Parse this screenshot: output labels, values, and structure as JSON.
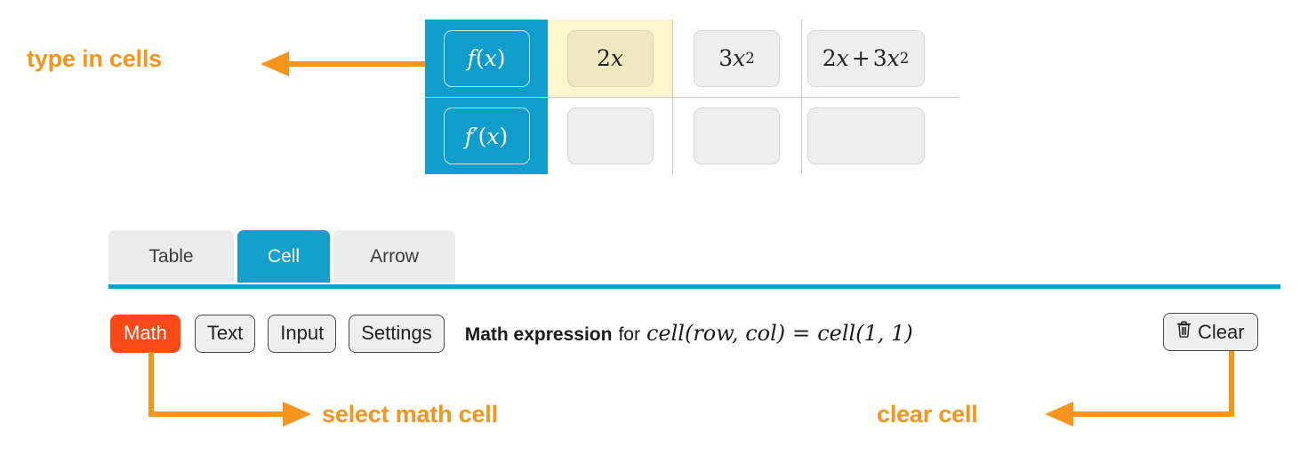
{
  "annotations": [
    {
      "id": "type-in-cells",
      "text": "type in cells"
    },
    {
      "id": "select-math-cell",
      "text": "select math cell"
    },
    {
      "id": "clear-cell",
      "text": "clear cell"
    }
  ],
  "colors": {
    "annotation_orange": "#F7941E",
    "tab_active_blue": "#14A0CC",
    "header_cell_blue": "#0F9DCB",
    "selected_cell_yellow": "#FCF6CD",
    "selected_cell_inner_yellow": "#EEE9C0",
    "primary_button_orange": "#FB4A16",
    "cell_fill_grey": "#EEEEEE",
    "grid_line_grey": "#C9C9C9"
  },
  "table": {
    "rows": [
      {
        "header": "f(x)",
        "header_parts": {
          "fn": "f",
          "open": "(",
          "var": "x",
          "close": ")"
        },
        "cells": [
          {
            "value": "2x",
            "state": "selected",
            "parts": {
              "coef": "2",
              "var": "x"
            }
          },
          {
            "value": "3x^2",
            "state": "filled",
            "parts": {
              "coef": "3",
              "var": "x",
              "exp": "2"
            }
          },
          {
            "value": "2x + 3x^2",
            "state": "filled",
            "parts": {
              "coef1": "2",
              "var1": "x",
              "op": "+",
              "coef2": "3",
              "var2": "x",
              "exp2": "2"
            }
          }
        ]
      },
      {
        "header": "f'(x)",
        "header_parts": {
          "fn": "f",
          "prime": "′",
          "open": "(",
          "var": "x",
          "close": ")"
        },
        "cells": [
          {
            "value": "",
            "state": "empty"
          },
          {
            "value": "",
            "state": "empty"
          },
          {
            "value": "",
            "state": "empty"
          }
        ]
      }
    ]
  },
  "tabs": [
    {
      "label": "Table",
      "active": false
    },
    {
      "label": "Cell",
      "active": true
    },
    {
      "label": "Arrow",
      "active": false
    }
  ],
  "toolbar": {
    "buttons": [
      {
        "label": "Math",
        "primary": true
      },
      {
        "label": "Text",
        "primary": false
      },
      {
        "label": "Input",
        "primary": false
      },
      {
        "label": "Settings",
        "primary": false
      }
    ],
    "status": {
      "strong": "Math expression",
      "connector": "for",
      "formula_left_fn": "cell",
      "formula_left_args": "(row, col)",
      "equals": "=",
      "formula_right_fn": "cell",
      "formula_right_args": "(1, 1)"
    },
    "clear_button": {
      "label": "Clear",
      "icon": "trash-icon",
      "icon_glyph": "🗑"
    }
  }
}
